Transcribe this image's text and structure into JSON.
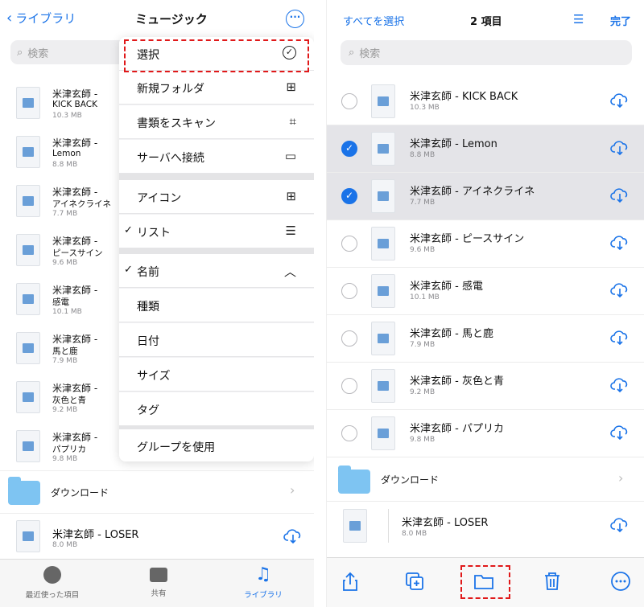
{
  "left": {
    "back_label": "ライブラリ",
    "title": "ミュージック",
    "more_icon": "ellipsis-circle-icon",
    "search_placeholder": "検索",
    "rows": [
      {
        "line1": "米津玄師 -",
        "line2": "KICK BACK",
        "size": "10.3 MB"
      },
      {
        "line1": "米津玄師 -",
        "line2": "Lemon",
        "size": "8.8 MB"
      },
      {
        "line1": "米津玄師 -",
        "line2": "アイネクライネ",
        "size": "7.7 MB"
      },
      {
        "line1": "米津玄師 -",
        "line2": "ピースサイン",
        "size": "9.6 MB"
      },
      {
        "line1": "米津玄師 -",
        "line2": "感電",
        "size": "10.1 MB"
      },
      {
        "line1": "米津玄師 -",
        "line2": "馬と鹿",
        "size": "7.9 MB"
      },
      {
        "line1": "米津玄師 -",
        "line2": "灰色と青",
        "size": "9.2 MB"
      },
      {
        "line1": "米津玄師 -",
        "line2": "パプリカ",
        "size": "9.8 MB"
      }
    ],
    "folder_label": "ダウンロード",
    "loser": {
      "name": "米津玄師 - LOSER",
      "size": "8.0 MB"
    },
    "tabs": [
      "最近使った項目",
      "共有",
      "ライブラリ"
    ]
  },
  "menu": {
    "items": [
      {
        "label": "選択",
        "icon": "checkmark-circle-icon"
      },
      {
        "label": "新規フォルダ",
        "icon": "folder-plus-icon"
      },
      {
        "label": "書類をスキャン",
        "icon": "doc-scan-icon"
      },
      {
        "label": "サーバへ接続",
        "icon": "display-icon"
      },
      {
        "label": "アイコン",
        "icon": "grid-icon"
      },
      {
        "label": "リスト",
        "icon": "list-icon",
        "checked": true
      },
      {
        "label": "名前",
        "icon": "chevron-up-icon",
        "checked": true
      },
      {
        "label": "種類"
      },
      {
        "label": "日付"
      },
      {
        "label": "サイズ"
      },
      {
        "label": "タグ"
      },
      {
        "label": "グループを使用"
      }
    ],
    "check_glyph": "✓"
  },
  "right": {
    "select_all": "すべてを選択",
    "count": "2 項目",
    "done": "完了",
    "search_placeholder": "検索",
    "rows": [
      {
        "name": "米津玄師 - KICK BACK",
        "size": "10.3 MB",
        "selected": false
      },
      {
        "name": "米津玄師 - Lemon",
        "size": "8.8 MB",
        "selected": true
      },
      {
        "name": "米津玄師 - アイネクライネ",
        "size": "7.7 MB",
        "selected": true
      },
      {
        "name": "米津玄師 - ピースサイン",
        "size": "9.6 MB",
        "selected": false
      },
      {
        "name": "米津玄師 - 感電",
        "size": "10.1 MB",
        "selected": false
      },
      {
        "name": "米津玄師 - 馬と鹿",
        "size": "7.9 MB",
        "selected": false
      },
      {
        "name": "米津玄師 - 灰色と青",
        "size": "9.2 MB",
        "selected": false
      },
      {
        "name": "米津玄師 - パプリカ",
        "size": "9.8 MB",
        "selected": false
      }
    ],
    "folder_label": "ダウンロード",
    "loser": {
      "name": "米津玄師 - LOSER",
      "size": "8.0 MB"
    },
    "toolbar_icons": [
      "share-icon",
      "duplicate-icon",
      "folder-icon",
      "trash-icon",
      "more-icon"
    ]
  },
  "colors": {
    "accent": "#1a73e8",
    "highlight": "#e0191a",
    "selected_row": "#e4e4e8"
  }
}
